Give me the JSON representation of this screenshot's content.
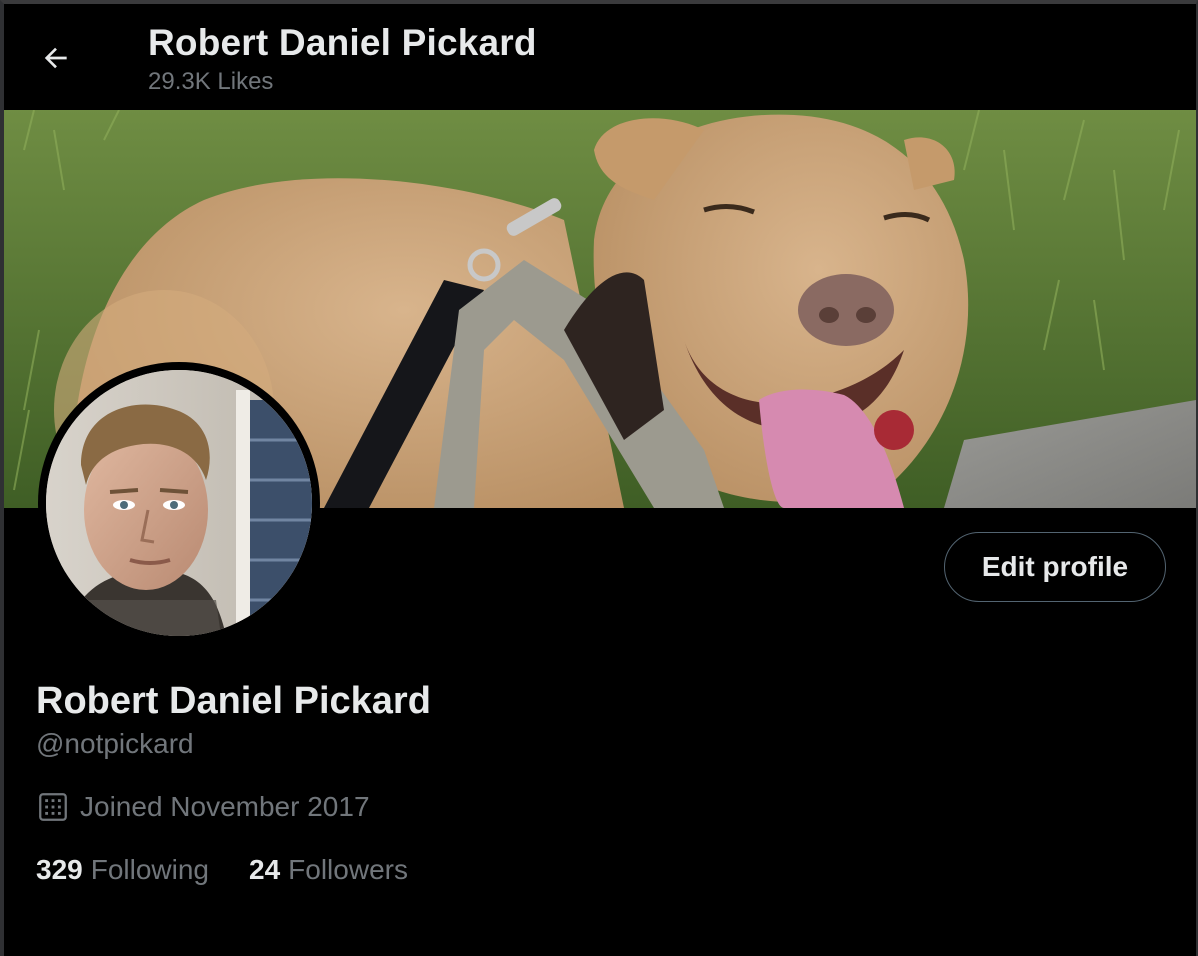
{
  "header": {
    "title": "Robert Daniel Pickard",
    "subtitle": "29.3K Likes",
    "back_icon": "arrow-left-icon"
  },
  "banner": {
    "image": "banner-photo-dog"
  },
  "avatar": {
    "image": "avatar-photo"
  },
  "actions": {
    "edit_profile_label": "Edit profile"
  },
  "profile": {
    "display_name": "Robert Daniel Pickard",
    "handle": "@notpickard",
    "joined_icon": "calendar-icon",
    "joined_text": "Joined November 2017",
    "following_count": "329",
    "following_label": "Following",
    "followers_count": "24",
    "followers_label": "Followers"
  },
  "colors": {
    "background": "#000000",
    "primary_text": "#e7e9ea",
    "secondary_text": "#71767b",
    "button_border": "#536471"
  }
}
